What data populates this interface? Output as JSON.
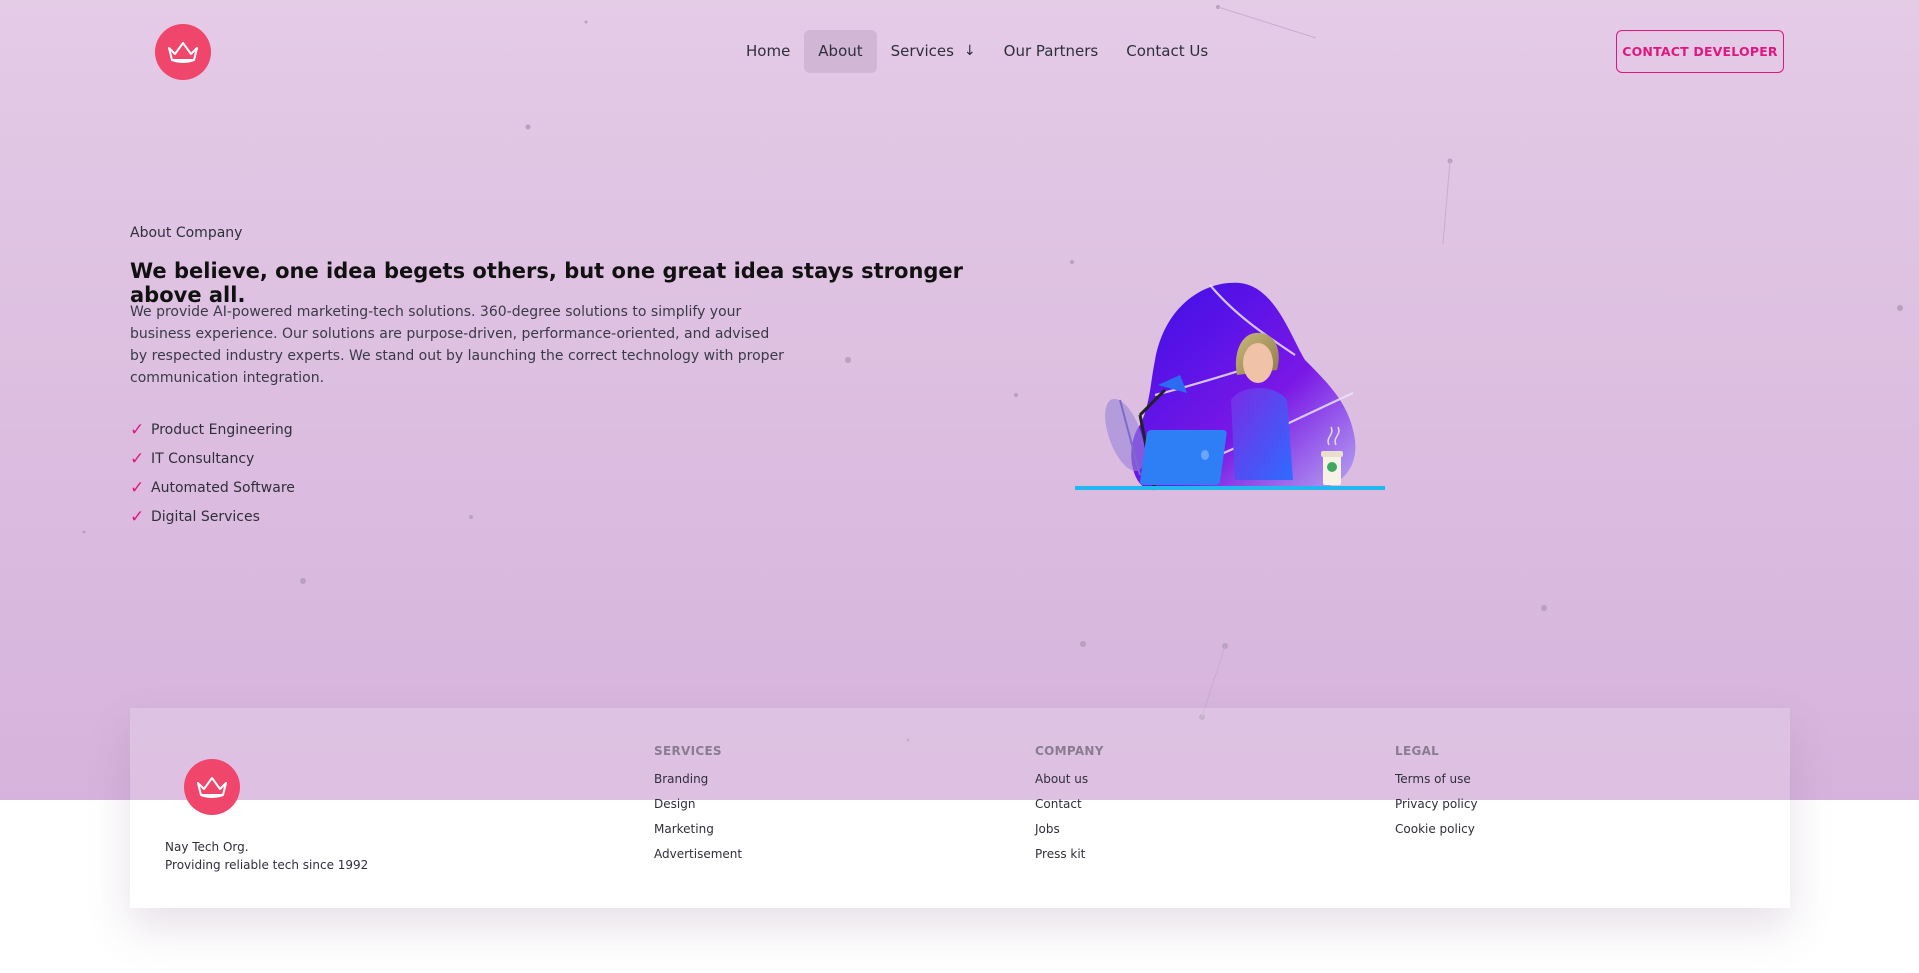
{
  "nav": {
    "logo_icon": "crown-icon",
    "items": [
      {
        "label": "Home",
        "active": false
      },
      {
        "label": "About",
        "active": true
      },
      {
        "label": "Services",
        "active": false,
        "dropdown": true
      },
      {
        "label": "Our Partners",
        "active": false
      },
      {
        "label": "Contact Us",
        "active": false
      }
    ],
    "cta_label": "CONTACT DEVELOPER"
  },
  "hero": {
    "eyebrow": "About Company",
    "headline": "We believe, one idea begets others, but one great idea stays stronger above all.",
    "description": "We provide AI-powered marketing-tech solutions. 360-degree solutions to simplify your business experience. Our solutions are purpose-driven, performance-oriented, and advised by respected industry experts. We stand out by launching the correct technology with proper communication integration.",
    "features": [
      "Product Engineering",
      "IT Consultancy",
      "Automated Software",
      "Digital Services"
    ],
    "check_symbol": "✓"
  },
  "footer": {
    "org_name": "Nay Tech Org.",
    "tagline": "Providing reliable tech since 1992",
    "columns": {
      "services": {
        "title": "SERVICES",
        "links": [
          "Branding",
          "Design",
          "Marketing",
          "Advertisement"
        ]
      },
      "company": {
        "title": "COMPANY",
        "links": [
          "About us",
          "Contact",
          "Jobs",
          "Press kit"
        ]
      },
      "legal": {
        "title": "LEGAL",
        "links": [
          "Terms of use",
          "Privacy policy",
          "Cookie policy"
        ]
      }
    }
  },
  "colors": {
    "brand": "#f0466b",
    "accent": "#e0177f",
    "background": "#e4cbe6"
  }
}
